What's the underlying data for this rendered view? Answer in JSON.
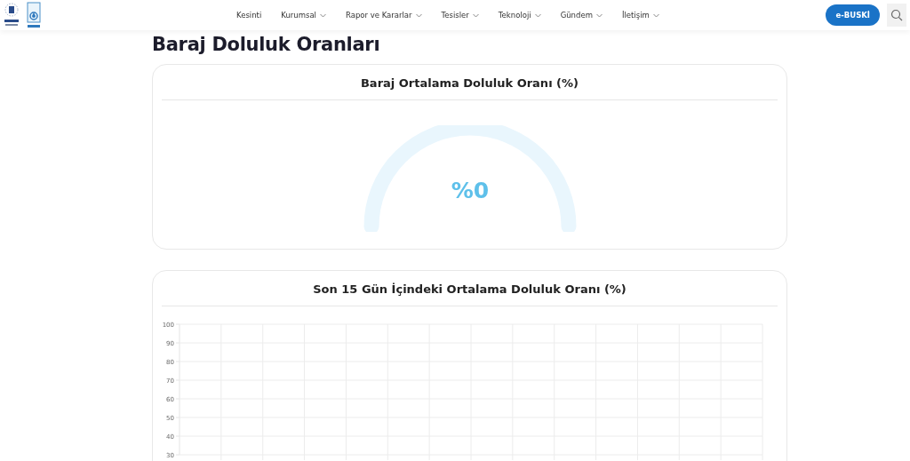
{
  "nav": {
    "items": [
      {
        "label": "Kesinti",
        "dropdown": false
      },
      {
        "label": "Kurumsal",
        "dropdown": true
      },
      {
        "label": "Rapor ve Kararlar",
        "dropdown": true
      },
      {
        "label": "Tesisler",
        "dropdown": true
      },
      {
        "label": "Teknoloji",
        "dropdown": true
      },
      {
        "label": "Gündem",
        "dropdown": true
      },
      {
        "label": "İletişim",
        "dropdown": true
      }
    ],
    "button": "e-BUSKİ"
  },
  "page_title": "Baraj Doluluk Oranları",
  "gauge_card": {
    "title": "Baraj Ortalama Doluluk Oranı (%)",
    "value": "%0"
  },
  "chart_card": {
    "title": "Son 15 Gün İçindeki Ortalama Doluluk Oranı (%)",
    "chart_data": {
      "type": "line",
      "categories": [
        null,
        null,
        null,
        null,
        null,
        null,
        null,
        null,
        null,
        null,
        null,
        null,
        null,
        null,
        null
      ],
      "values": [
        null,
        null,
        null,
        null,
        null,
        null,
        null,
        null,
        null,
        null,
        null,
        null,
        null,
        null,
        null
      ],
      "grid": true,
      "ylim": [
        30,
        100
      ],
      "yticks": [
        30,
        40,
        50,
        60,
        70,
        80,
        90,
        100
      ]
    }
  }
}
